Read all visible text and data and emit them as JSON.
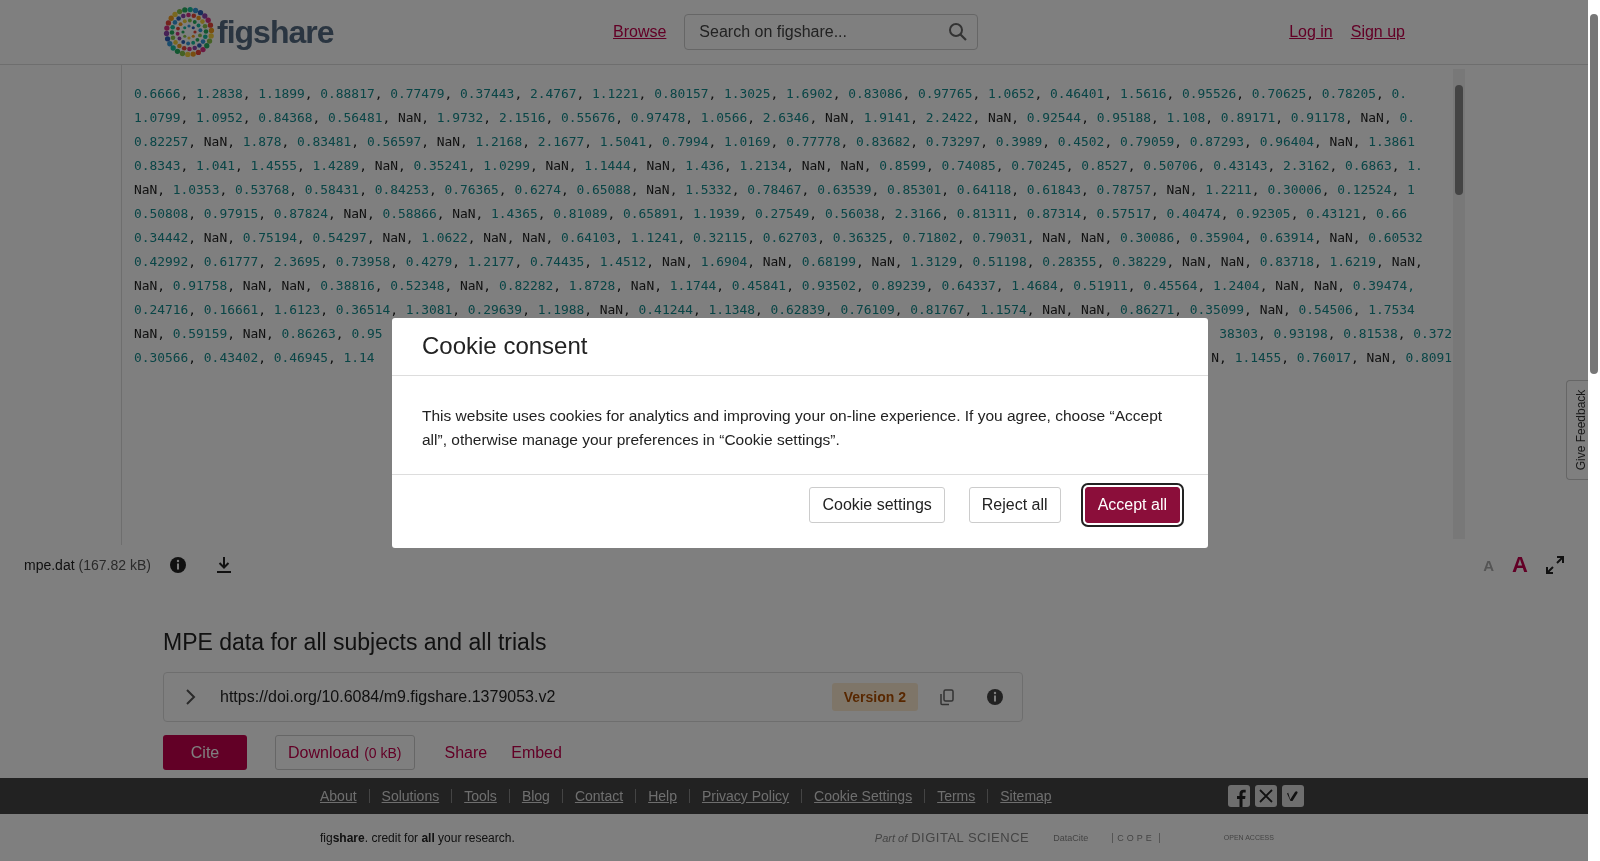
{
  "header": {
    "logo_text": "figshare",
    "nav_link": "Browse",
    "search": {
      "placeholder": "Search on figshare..."
    },
    "auth_links": [
      "Log in",
      "Sign up"
    ]
  },
  "data_view": {
    "rows": [
      {
        "text": "0.6666, 1.2838, 1.1899, 0.88817, 0.77479, 0.37443, 2.4767, 1.1221, 0.80157, 1.3025, 1.6902, 0.83086, 0.97765, 1.0652, 0.46401, 1.5616, 0.95526, 0.70625, 0.78205, 0."
      },
      {
        "text": "1.0799, 1.0952, 0.84368, 0.56481, NaN, 1.9732, 2.1516, 0.55676, 0.97478, 1.0566, 2.6346, NaN, 1.9141, 2.2422, NaN, 0.92544, 0.95188, 1.108, 0.89171, 0.91178, NaN, 0."
      },
      {
        "text": "0.82257, NaN, 1.878, 0.83481, 0.56597, NaN, 1.2168, 2.1677, 1.5041, 0.7994, 1.0169, 0.77778, 0.83682, 0.73297, 0.3989, 0.4502, 0.79059, 0.87293, 0.96404, NaN, 1.3861"
      },
      {
        "text": "0.8343, 1.041, 1.4555, 1.4289, NaN, 0.35241, 1.0299, NaN, 1.1444, NaN, 1.436, 1.2134, NaN, NaN, 0.8599, 0.74085, 0.70245, 0.8527, 0.50706, 0.43143, 2.3162, 0.6863, 1."
      },
      {
        "text": "NaN, 1.0353, 0.53768, 0.58431, 0.84253, 0.76365, 0.6274, 0.65088, NaN, 1.5332, 0.78467, 0.63539, 0.85301, 0.64118, 0.61843, 0.78757, NaN, 1.2211, 0.30006, 0.12524, 1"
      },
      {
        "text": "0.50808, 0.97915, 0.87824, NaN, 0.58866, NaN, 1.4365, 0.81089, 0.65891, 1.1939, 0.27549, 0.56038, 2.3166, 0.81311, 0.87314, 0.57517, 0.40474, 0.92305, 0.43121, 0.66"
      },
      {
        "text": "0.34442, NaN, 0.75194, 0.54297, NaN, 1.0622, NaN, NaN, 0.64103, 1.1241, 0.32115, 0.62703, 0.36325, 0.71802, 0.79031, NaN, NaN, 0.30086, 0.35904, 0.63914, NaN, 0.60532"
      },
      {
        "text": "0.42992, 0.61777, 2.3695, 0.73958, 0.4279, 1.2177, 0.74435, 1.4512, NaN, 1.6904, NaN, 0.68199, NaN, 1.3129, 0.51198, 0.28355, 0.38229, NaN, NaN, 0.83718, 1.6219, NaN,"
      },
      {
        "text": "NaN, 0.91758, NaN, NaN, 0.38816, 0.52348, NaN, 0.82282, 1.8728, NaN, 1.1744, 0.45841, 0.93502, 0.89239, 0.64337, 1.4684, 0.51911, 0.45564, 1.2404, NaN, NaN, 0.39474,"
      },
      {
        "text": "0.24716, 0.16661, 1.6123, 0.36514, 1.3081, 0.29639, 1.1988, NaN, 0.41244, 1.1348, 0.62839, 0.76109, 0.81767, 1.1574, NaN, NaN, 0.86271, 0.35099, NaN, 0.54506, 1.7534"
      },
      {
        "text": "NaN, 0.59159, NaN, 0.86263, 0.95",
        "right": "38303, 0.93198, 0.81538, 0.372"
      },
      {
        "text": "0.30566, 0.43402, 0.46945, 1.14",
        "right": "N, 1.1455, 0.76017, NaN, 0.8091"
      }
    ]
  },
  "file_bar": {
    "name": "mpe.dat",
    "size": "(167.82 kB)",
    "text_size_buttons": [
      {
        "label": "A",
        "kind": "small",
        "selected": false
      },
      {
        "label": "A",
        "kind": "large",
        "selected": true
      }
    ]
  },
  "item": {
    "title": "MPE data for all subjects and all trials",
    "doi": "https://doi.org/10.6084/m9.figshare.1379053.v2",
    "version": "Version 2",
    "actions": [
      {
        "kind": "primary",
        "label": "Cite"
      },
      {
        "kind": "outline",
        "label": "Download",
        "note": "(0 kB)"
      },
      {
        "kind": "link",
        "label": "Share"
      },
      {
        "kind": "link",
        "label": "Embed"
      }
    ]
  },
  "feedback_tab": "Give Feedback",
  "footer": {
    "links": [
      "About",
      "Solutions",
      "Tools",
      "Blog",
      "Contact",
      "Help",
      "Privacy Policy",
      "Cookie Settings",
      "Terms",
      "Sitemap"
    ],
    "tagline": "fig**share**. credit for **all** your research.",
    "partners": [
      "Part of",
      "DIGITAL SCIENCE",
      "DataCite",
      "COPE",
      "OPEN ACCESS"
    ]
  },
  "cookie_modal": {
    "title": "Cookie consent",
    "text": "This website uses cookies for analytics and improving your on-line experience. If you agree, choose “Accept all”, otherwise manage your preferences in “Cookie settings”.",
    "buttons": [
      {
        "label": "Cookie settings",
        "kind": "secondary"
      },
      {
        "label": "Reject all",
        "kind": "secondary"
      },
      {
        "label": "Accept all",
        "kind": "primary"
      }
    ]
  }
}
